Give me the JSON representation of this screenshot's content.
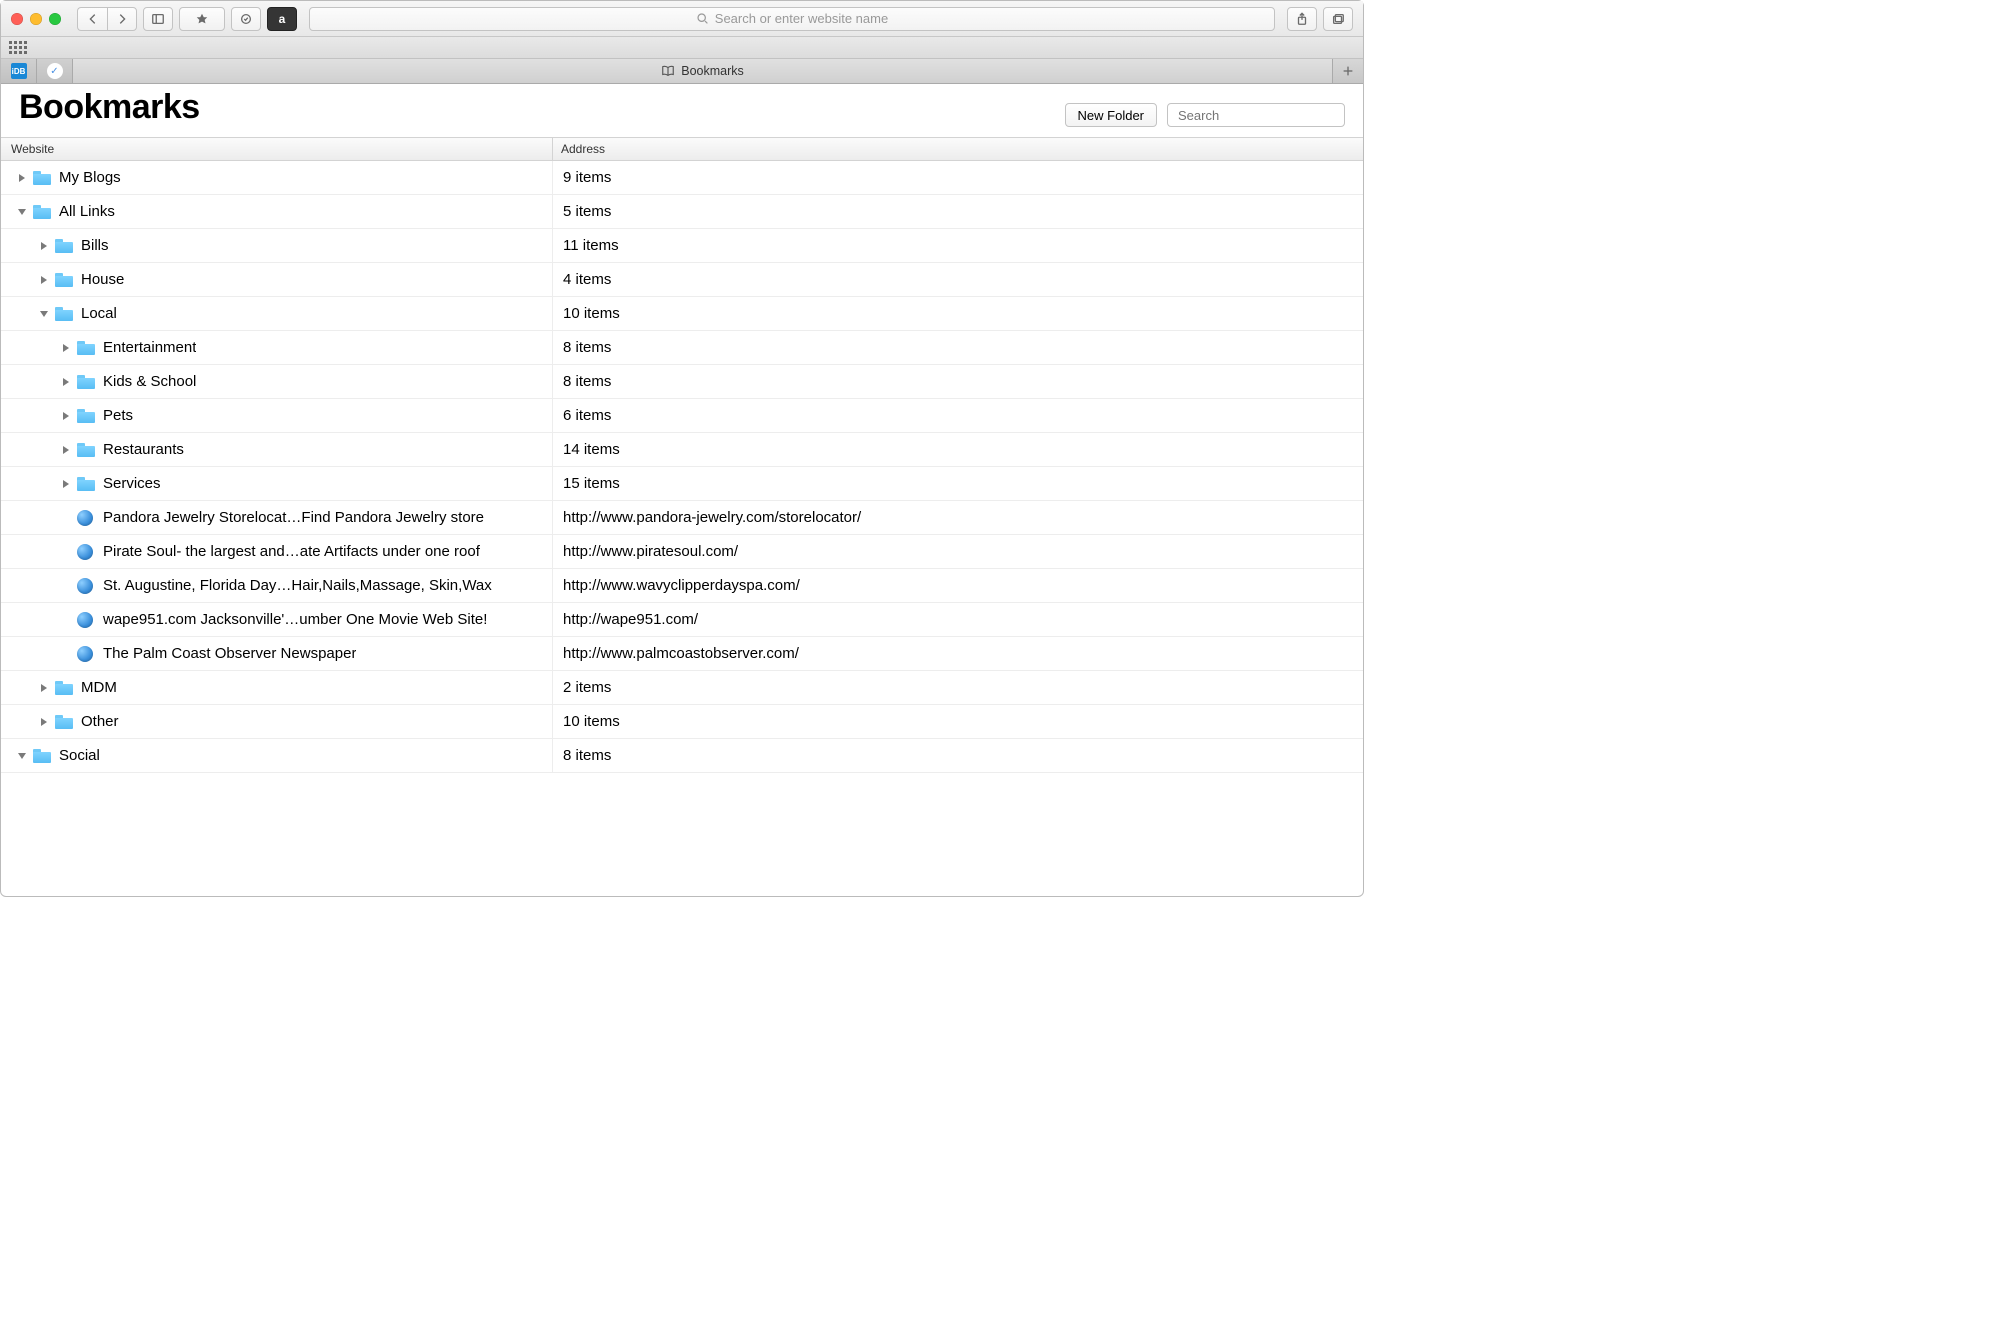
{
  "toolbar": {
    "address_placeholder": "Search or enter website name",
    "pinned_idb_label": "iDB"
  },
  "tab": {
    "title": "Bookmarks"
  },
  "page": {
    "title": "Bookmarks",
    "new_folder_label": "New Folder",
    "search_placeholder": "Search"
  },
  "columns": {
    "website": "Website",
    "address": "Address"
  },
  "rows": [
    {
      "indent": 0,
      "type": "folder",
      "expanded": false,
      "name": "My Blogs",
      "address": "9 items"
    },
    {
      "indent": 0,
      "type": "folder",
      "expanded": true,
      "name": "All Links",
      "address": "5 items"
    },
    {
      "indent": 1,
      "type": "folder",
      "expanded": false,
      "name": "Bills",
      "address": "11 items"
    },
    {
      "indent": 1,
      "type": "folder",
      "expanded": false,
      "name": "House",
      "address": "4 items"
    },
    {
      "indent": 1,
      "type": "folder",
      "expanded": true,
      "name": "Local",
      "address": "10 items"
    },
    {
      "indent": 2,
      "type": "folder",
      "expanded": false,
      "name": "Entertainment",
      "address": "8 items"
    },
    {
      "indent": 2,
      "type": "folder",
      "expanded": false,
      "name": "Kids & School",
      "address": "8 items"
    },
    {
      "indent": 2,
      "type": "folder",
      "expanded": false,
      "name": "Pets",
      "address": "6 items"
    },
    {
      "indent": 2,
      "type": "folder",
      "expanded": false,
      "name": "Restaurants",
      "address": "14 items"
    },
    {
      "indent": 2,
      "type": "folder",
      "expanded": false,
      "name": "Services",
      "address": "15 items"
    },
    {
      "indent": 2,
      "type": "bookmark",
      "name": "Pandora Jewelry Storelocat…Find Pandora Jewelry store",
      "address": "http://www.pandora-jewelry.com/storelocator/"
    },
    {
      "indent": 2,
      "type": "bookmark",
      "name": "Pirate Soul- the largest and…ate Artifacts under one roof",
      "address": "http://www.piratesoul.com/"
    },
    {
      "indent": 2,
      "type": "bookmark",
      "name": "St. Augustine, Florida Day…Hair,Nails,Massage, Skin,Wax",
      "address": "http://www.wavyclipperdayspa.com/"
    },
    {
      "indent": 2,
      "type": "bookmark",
      "name": "wape951.com Jacksonville'…umber One Movie Web Site!",
      "address": "http://wape951.com/"
    },
    {
      "indent": 2,
      "type": "bookmark",
      "name": "The Palm Coast Observer Newspaper",
      "address": "http://www.palmcoastobserver.com/"
    },
    {
      "indent": 1,
      "type": "folder",
      "expanded": false,
      "name": "MDM",
      "address": "2 items"
    },
    {
      "indent": 1,
      "type": "folder",
      "expanded": false,
      "name": "Other",
      "address": "10 items"
    },
    {
      "indent": 0,
      "type": "folder",
      "expanded": true,
      "name": "Social",
      "address": "8 items"
    }
  ]
}
